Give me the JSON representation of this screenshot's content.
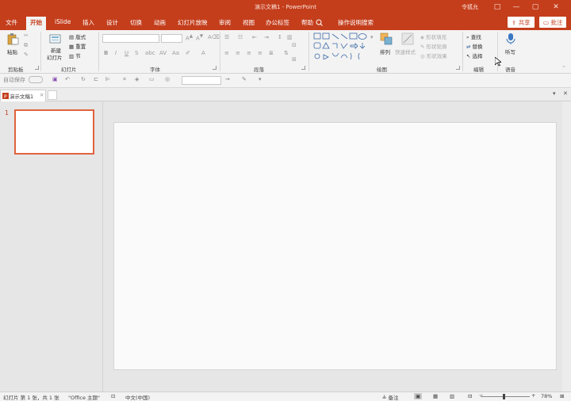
{
  "window": {
    "title": "演示文稿1  -  PowerPoint",
    "user": "令狐允",
    "controls": [
      "□",
      "—",
      "▢",
      "✕"
    ]
  },
  "menu": {
    "tabs": [
      "文件",
      "开始",
      "iSlide",
      "插入",
      "设计",
      "切换",
      "动画",
      "幻灯片放映",
      "审阅",
      "视图",
      "办公标签",
      "帮助"
    ],
    "search": "操作说明搜索",
    "share": "共享",
    "comment": "批注"
  },
  "ribbon": {
    "clipboard": {
      "paste": "粘贴",
      "label": "剪贴板"
    },
    "slides": {
      "new_slide": "新建",
      "new_slide2": "幻灯片",
      "layout": "版式",
      "reset": "重置",
      "section": "节",
      "label": "幻灯片"
    },
    "font": {
      "bold": "B",
      "italic": "I",
      "underline": "U",
      "strike": "S",
      "label": "字体"
    },
    "paragraph": {
      "label": "段落"
    },
    "drawing": {
      "arrange": "排列",
      "quick_styles": "快速样式",
      "shape_fill": "形状填充",
      "shape_outline": "形状轮廓",
      "shape_effects": "形状效果",
      "label": "绘图"
    },
    "editing": {
      "find": "查找",
      "replace": "替换",
      "select": "选择",
      "label": "编辑"
    },
    "voice": {
      "dictate": "听写",
      "label": "语音"
    }
  },
  "qat": {
    "autosave": "自动保存"
  },
  "doc_tab": {
    "name": "演示文稿1",
    "close": "✕"
  },
  "thumbnails": {
    "slide_number": "1"
  },
  "statusbar": {
    "slide_info": "幻灯片 第 1 张，共 1 张",
    "theme": "\"Office 主题\"",
    "language": "中文(中国)",
    "notes": "备注",
    "zoom": "78%"
  },
  "colors": {
    "accent": "#c43e1c",
    "selection": "#e0633f"
  }
}
